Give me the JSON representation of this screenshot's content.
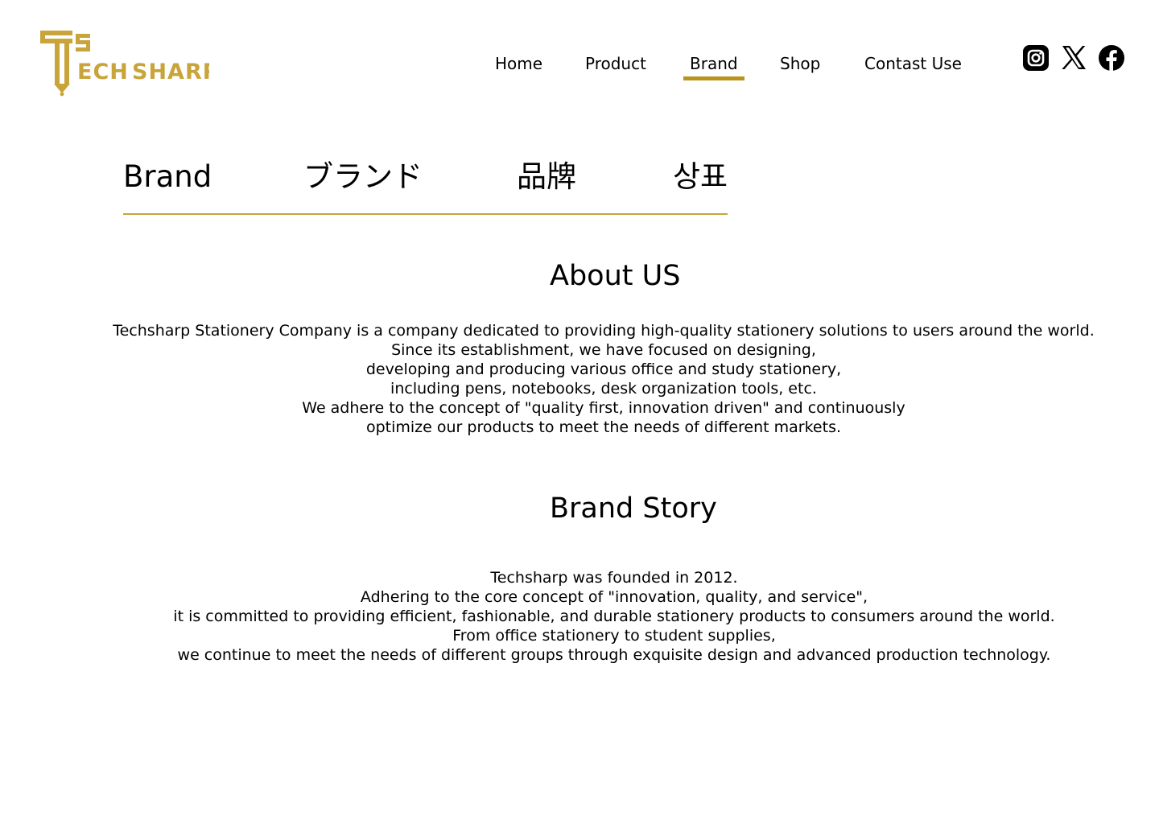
{
  "brand": {
    "logo_letters": "TS",
    "logo_text": "ECH SHARP",
    "color": "#C9A43A"
  },
  "nav": {
    "items": [
      {
        "label": "Home"
      },
      {
        "label": "Product"
      },
      {
        "label": "Brand"
      },
      {
        "label": "Shop"
      },
      {
        "label": "Contast Use"
      }
    ],
    "active": "Brand",
    "active_color": "#B8941F"
  },
  "social": [
    {
      "icon": "instagram-icon"
    },
    {
      "icon": "x-icon"
    },
    {
      "icon": "facebook-icon"
    }
  ],
  "language_tabs": [
    "Brand",
    "ブランド",
    "品牌",
    "상표"
  ],
  "about": {
    "title": "About US",
    "lines": [
      "Techsharp Stationery Company is a company dedicated to providing high-quality stationery solutions to users around the world.",
      "Since its establishment, we have focused on designing,",
      "developing and producing various office and study stationery,",
      "including pens, notebooks, desk organization tools, etc.",
      "We adhere to the concept of \"quality first, innovation driven\" and continuously",
      "optimize our products to meet the needs of different markets."
    ]
  },
  "story": {
    "title": "Brand Story",
    "lines": [
      "Techsharp was founded in 2012.",
      "Adhering to the core concept of \"innovation, quality, and service\",",
      "it is committed to providing efficient, fashionable, and durable stationery products to consumers around the world.",
      "From office stationery to student supplies,",
      "we continue to meet the needs of different groups through exquisite design and advanced production technology."
    ]
  }
}
